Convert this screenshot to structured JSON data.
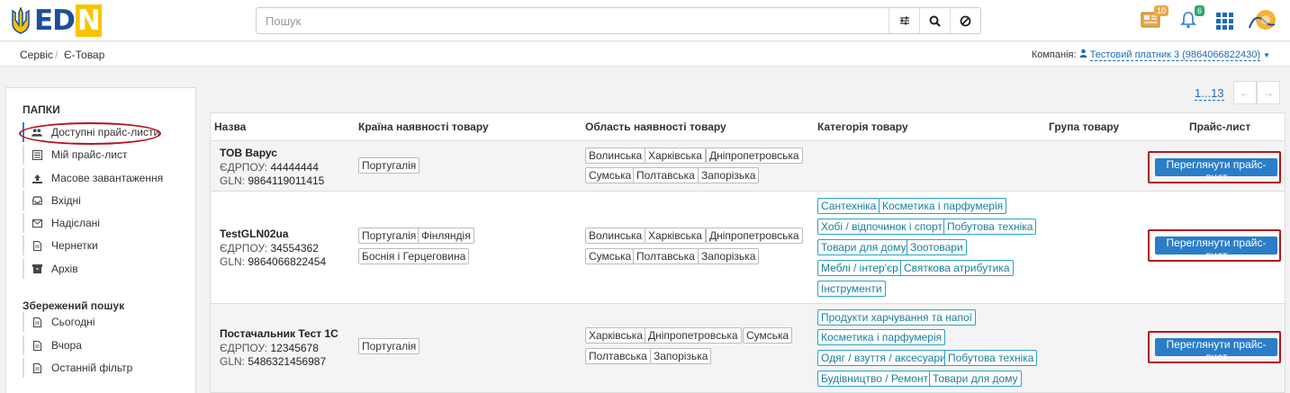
{
  "app": {
    "logo_text_blue": "ED",
    "logo_text_n": "N"
  },
  "search": {
    "placeholder": "Пошук"
  },
  "top_icons": {
    "news_badge": "10",
    "bell_badge": "6"
  },
  "breadcrumb": {
    "items": [
      "Сервіс",
      "Є-Товар"
    ],
    "separator": "/"
  },
  "company": {
    "label": "Компанія:",
    "value": "Тестовий платник 3 (9864066822430)"
  },
  "sidebar": {
    "folders_title": "ПАПКИ",
    "items": [
      {
        "label": "Доступні прайс-листи",
        "icon": "users-icon"
      },
      {
        "label": "Мій прайс-лист",
        "icon": "list-icon"
      },
      {
        "label": "Масове завантаження",
        "icon": "upload-icon"
      },
      {
        "label": "Вхідні",
        "icon": "inbox-icon"
      },
      {
        "label": "Надіслані",
        "icon": "envelope-icon"
      },
      {
        "label": "Чернетки",
        "icon": "file-icon"
      },
      {
        "label": "Архів",
        "icon": "archive-icon"
      }
    ],
    "saved_title": "Збережений пошук",
    "saved": [
      {
        "label": "Сьогодні",
        "icon": "file-icon"
      },
      {
        "label": "Вчора",
        "icon": "file-icon"
      },
      {
        "label": "Останній фільтр",
        "icon": "file-icon"
      }
    ]
  },
  "pager": {
    "range": "1...13",
    "prev": "←",
    "next": "→"
  },
  "table": {
    "headers": [
      "Назва",
      "Країна наявності товару",
      "Область наявності товару",
      "Категорія товару",
      "Група товару",
      "Прайс-лист"
    ],
    "button_label": "Переглянути прайс-лист",
    "rows": [
      {
        "name": "ТОВ Варус",
        "edrpou_label": "ЄДРПОУ:",
        "edrpou": "44444444",
        "gln_label": "GLN:",
        "gln": "9864119011415",
        "countries": [
          "Португалія"
        ],
        "regions": [
          "Волинська",
          "Харківська",
          "Дніпропетровська",
          "Сумська",
          "Полтавська",
          "Запорізька"
        ],
        "categories": []
      },
      {
        "name": "TestGLN02ua",
        "edrpou_label": "ЄДРПОУ:",
        "edrpou": "34554362",
        "gln_label": "GLN:",
        "gln": "9864066822454",
        "countries": [
          "Португалія",
          "Фінляндія",
          "Боснія і Герцеговина"
        ],
        "regions": [
          "Волинська",
          "Харківська",
          "Дніпропетровська",
          "Сумська",
          "Полтавська",
          "Запорізька"
        ],
        "categories": [
          "Сантехніка",
          "Косметика і парфумерія",
          "Хобі / відпочинок і спорт",
          "Побутова техніка",
          "Товари для дому",
          "Зоотовари",
          "Меблі / інтер'єр",
          "Святкова атрибутика",
          "Інструменти"
        ]
      },
      {
        "name": "Постачальник Тест 1С",
        "edrpou_label": "ЄДРПОУ:",
        "edrpou": "12345678",
        "gln_label": "GLN:",
        "gln": "5486321456987",
        "countries": [
          "Португалія"
        ],
        "regions": [
          "Харківська",
          "Дніпропетровська",
          "Сумська",
          "Полтавська",
          "Запорізька"
        ],
        "categories": [
          "Продукти харчування та напої",
          "Косметика і парфумерія",
          "Одяг / взуття / аксесуари",
          "Побутова техніка",
          "Будівництво / Ремонт",
          "Товари для дому"
        ]
      }
    ]
  },
  "colors": {
    "brand": "#1b4f9c",
    "accent": "#2a7dc8",
    "highlight": "#b3141c",
    "category": "#29a3c4"
  }
}
